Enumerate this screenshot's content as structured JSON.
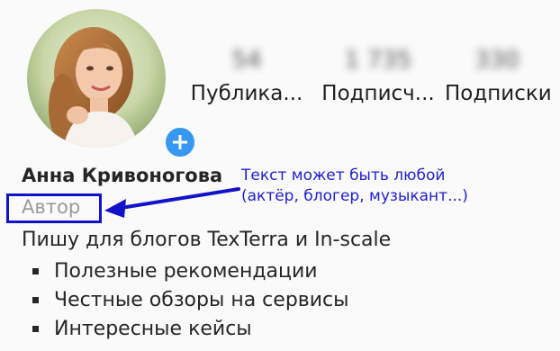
{
  "profile": {
    "name": "Анна Кривоногова",
    "category": "Автор",
    "bio": "Пишу для блогов TexTerra и In-scale",
    "bio_items": [
      "Полезные рекомендации",
      "Честные обзоры на сервисы",
      "Интересные кейсы"
    ]
  },
  "stats": [
    {
      "value": "54",
      "label": "Публика..."
    },
    {
      "value": "1 735",
      "label": "Подписч..."
    },
    {
      "value": "330",
      "label": "Подписки"
    }
  ],
  "annotation": {
    "line1": "Текст может быть любой",
    "line2": "(актёр, блогер, музыкант...)"
  },
  "colors": {
    "accent": "#3897f0",
    "annotation": "#1f1fc9",
    "secondary_text": "#9a9a9a"
  },
  "icons": {
    "add": "plus-icon",
    "arrow": "arrow-left-icon"
  }
}
